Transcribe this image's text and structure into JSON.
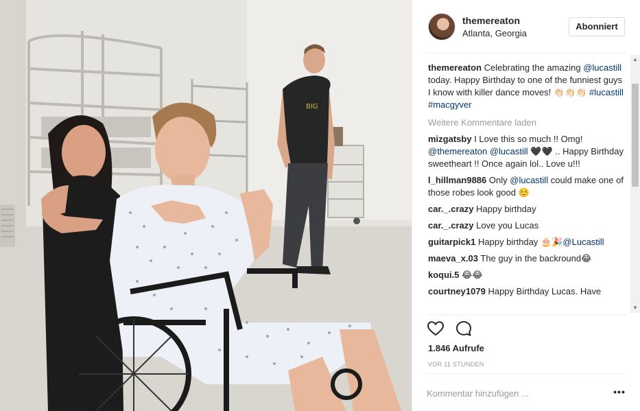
{
  "post": {
    "username": "themereaton",
    "location": "Atlanta, Georgia",
    "follow_label": "Abonniert",
    "caption": {
      "user": "themereaton",
      "text_1": "Celebrating the amazing",
      "mention": "@lucastill",
      "text_2": "today. Happy Birthday to one of the funniest guys I know with killer dance moves! 👏🏻👏🏻👏🏻",
      "tag_1": "#lucastill",
      "tag_2": "#macgyver"
    },
    "load_more_label": "Weitere Kommentare laden",
    "comments": [
      {
        "user": "mizgatsby",
        "text_1": "I Love this so much !! Omg!",
        "mention_1": "@themereaton",
        "mention_2": "@lucastill",
        "text_2": "🖤🖤 .. Happy Birthday sweetheart !! Once again lol.. Love u!!!"
      },
      {
        "user": "l_hillman9886",
        "text_1": "Only",
        "mention_1": "@lucastill",
        "text_2": "could make one of those robes look good ☺️"
      },
      {
        "user": "car._.crazy",
        "text_1": "Happy birthday"
      },
      {
        "user": "car._.crazy",
        "text_1": "Love you Lucas"
      },
      {
        "user": "guitarpick1",
        "text_1": "Happy birthday 🎂🎉",
        "mention_1": "@Lucastill"
      },
      {
        "user": "maeva_x.03",
        "text_1": "The guy in the backround😂"
      },
      {
        "user": "koqui.5",
        "text_1": "😂😂"
      },
      {
        "user": "courtney1079",
        "text_1": "Happy Birthday Lucas. Have"
      }
    ],
    "views": "1.846 Aufrufe",
    "timestamp": "VOR 11 STUNDEN",
    "comment_placeholder": "Kommentar hinzufügen ...",
    "more_options": "•••",
    "icons": {
      "like": "heart-icon",
      "comment": "comment-bubble-icon"
    },
    "colors": {
      "link": "#003569",
      "muted": "#999999",
      "text": "#262626",
      "border": "#efefef"
    }
  }
}
